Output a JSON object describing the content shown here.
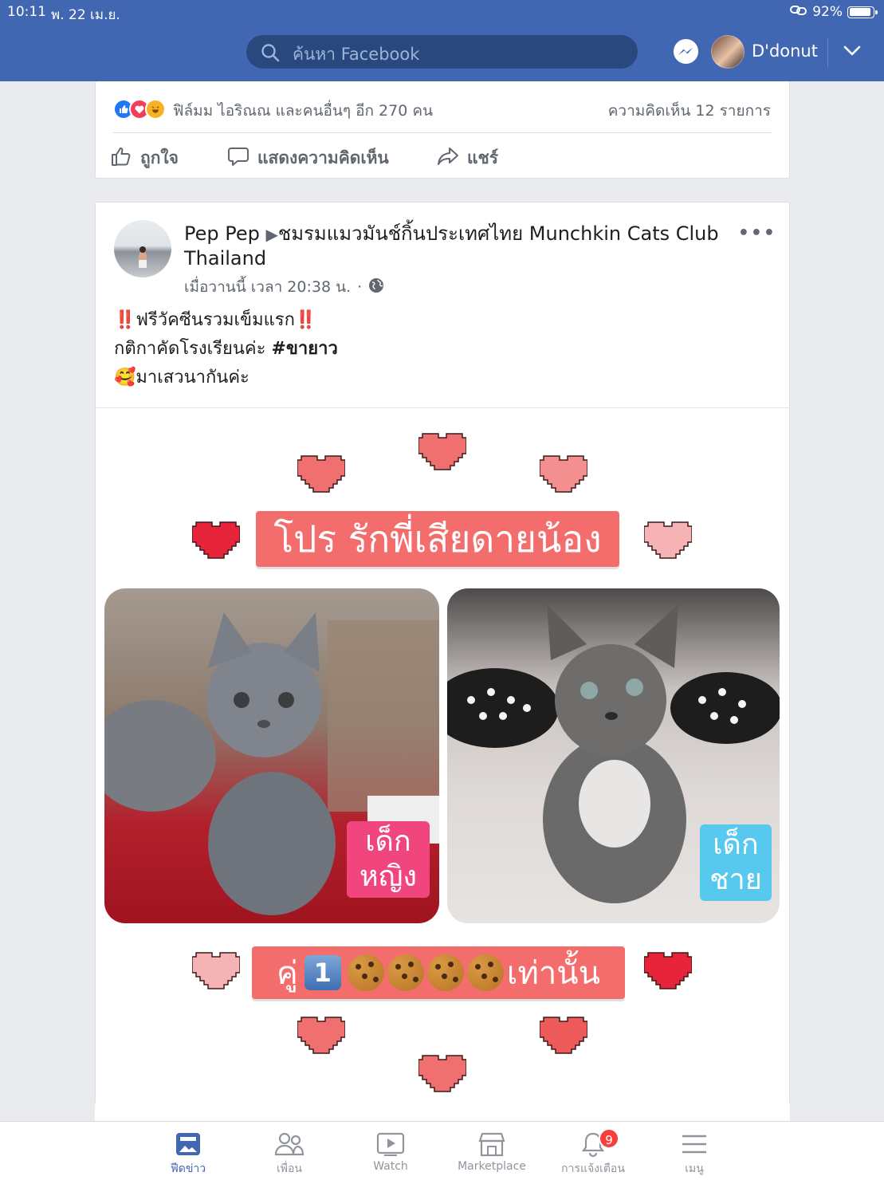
{
  "status_bar": {
    "time": "10:11",
    "date": "พ. 22 เม.ย.",
    "battery": "92%",
    "battery_level": 0.92
  },
  "header": {
    "search_placeholder": "ค้นหา Facebook",
    "user_name": "D'donut"
  },
  "prev_post": {
    "reactions_text": "ฟิล์มม ไอริณณ และคนอื่นๆ อีก 270 คน",
    "comments_text": "ความคิดเห็น 12 รายการ",
    "like_label": "ถูกใจ",
    "comment_label": "แสดงความคิดเห็น",
    "share_label": "แชร์"
  },
  "post": {
    "author": "Pep Pep",
    "group": "ชมรมแมวมันช์กิ้นประเทศไทย Munchkin Cats Club Thailand",
    "time": "เมื่อวานนี้ เวลา 20:38 น.",
    "line1": "ฟรีวัคซีนรวมเข็มแรก",
    "line2_prefix": "กติกาคัดโรงเรียนค่ะ ",
    "line2_hashtag": "#ขายาว",
    "line3": "มาเสวนากันค่ะ",
    "emoji_exclaim": "‼️",
    "emoji_face": "🥰"
  },
  "image": {
    "banner_top": "โปร รักพี่เสียดายน้อง",
    "tag_female": "เด็ก หญิง",
    "tag_male": "เด็ก ชาย",
    "banner_bottom_prefix": "คู่",
    "banner_bottom_number": "1",
    "banner_bottom_suffix": "เท่านั้น"
  },
  "tabs": [
    {
      "label": "ฟีดข่าว"
    },
    {
      "label": "เพื่อน"
    },
    {
      "label": "Watch"
    },
    {
      "label": "Marketplace"
    },
    {
      "label": "การแจ้งเตือน",
      "badge": "9"
    },
    {
      "label": "เมนู"
    }
  ],
  "colors": {
    "brand": "#4267b2",
    "banner": "#f36d6d",
    "tag_pink": "#f0457d",
    "tag_blue": "#57c9ef",
    "heart_red": "#e8243a",
    "heart_pink": "#f6b3b6"
  }
}
